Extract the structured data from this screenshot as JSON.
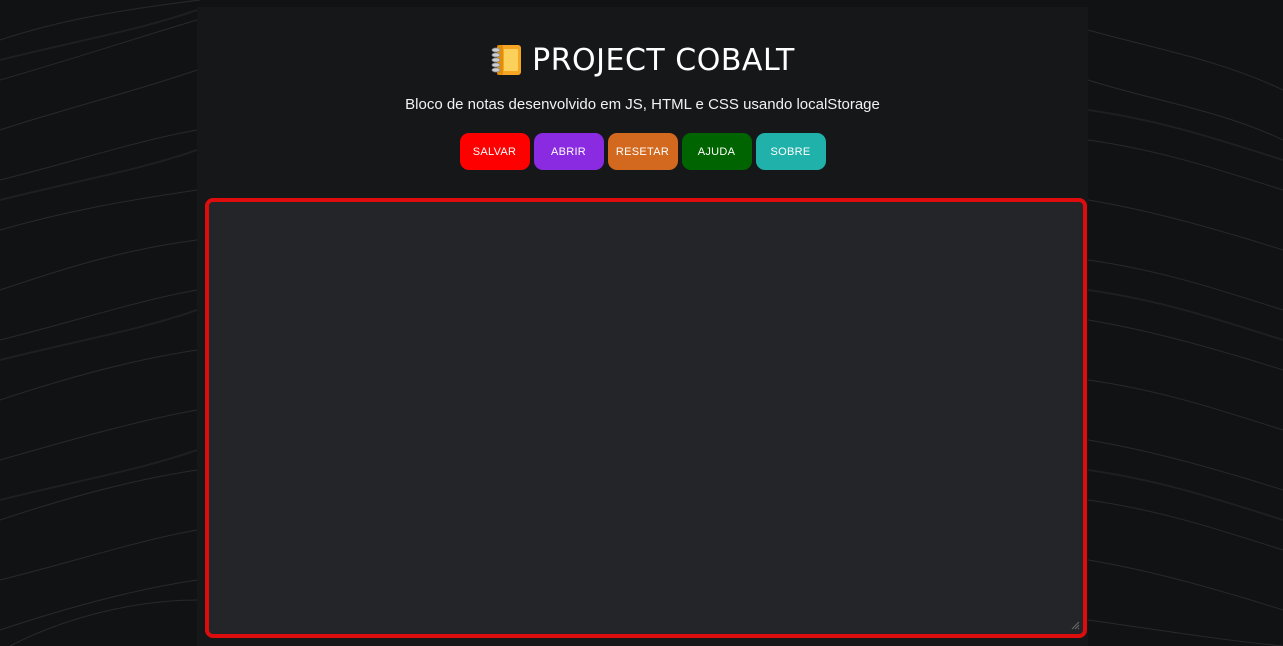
{
  "app": {
    "title": "PROJECT COBALT",
    "title_icon": "notebook-emoji",
    "subtitle": "Bloco de notas desenvolvido em JS, HTML e CSS usando localStorage"
  },
  "toolbar": {
    "buttons": [
      {
        "label": "SALVAR",
        "color": "#ff0000"
      },
      {
        "label": "ABRIR",
        "color": "#8a2be2"
      },
      {
        "label": "RESETAR",
        "color": "#d2691e"
      },
      {
        "label": "AJUDA",
        "color": "#006400"
      },
      {
        "label": "SOBRE",
        "color": "#20b2aa"
      }
    ]
  },
  "editor": {
    "value": "",
    "border_color": "#dd0d0d",
    "background": "#242528"
  },
  "colors": {
    "page_background": "#111213",
    "panel_background": "#151719"
  }
}
